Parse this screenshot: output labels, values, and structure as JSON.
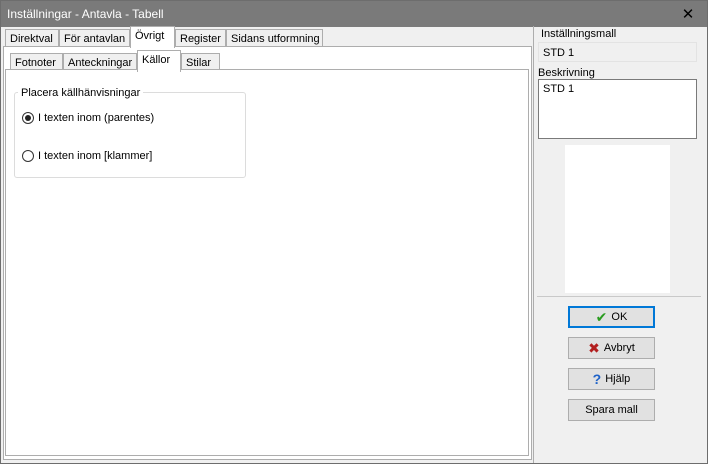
{
  "window": {
    "title": "Inställningar - Antavla - Tabell",
    "close_glyph": "✕"
  },
  "tabs_top": [
    {
      "label": "Direktval"
    },
    {
      "label": "För antavlan"
    },
    {
      "label": "Övrigt"
    },
    {
      "label": "Register"
    },
    {
      "label": "Sidans utformning"
    }
  ],
  "tabs_sub": [
    {
      "label": "Fotnoter"
    },
    {
      "label": "Anteckningar"
    },
    {
      "label": "Källor"
    },
    {
      "label": "Stilar"
    }
  ],
  "sources": {
    "group_title": "Placera källhänvisningar",
    "options": [
      {
        "label": "I texten inom (parentes)",
        "checked": true
      },
      {
        "label": "I texten inom [klammer]",
        "checked": false
      }
    ]
  },
  "template": {
    "label": "Inställningsmall",
    "value": "STD 1",
    "description_label": "Beskrivning",
    "description_value": "STD 1"
  },
  "buttons": {
    "ok": "OK",
    "cancel": "Avbryt",
    "help": "Hjälp",
    "save": "Spara mall"
  },
  "icons": {
    "ok": "✔",
    "cancel": "✖",
    "help": "?"
  },
  "colors": {
    "titlebar": "#7a7a7a",
    "ok_icon": "#2a9c1f",
    "cancel_icon": "#b21e1e",
    "help_icon": "#1e62c8",
    "default_button_border": "#0078d7"
  }
}
